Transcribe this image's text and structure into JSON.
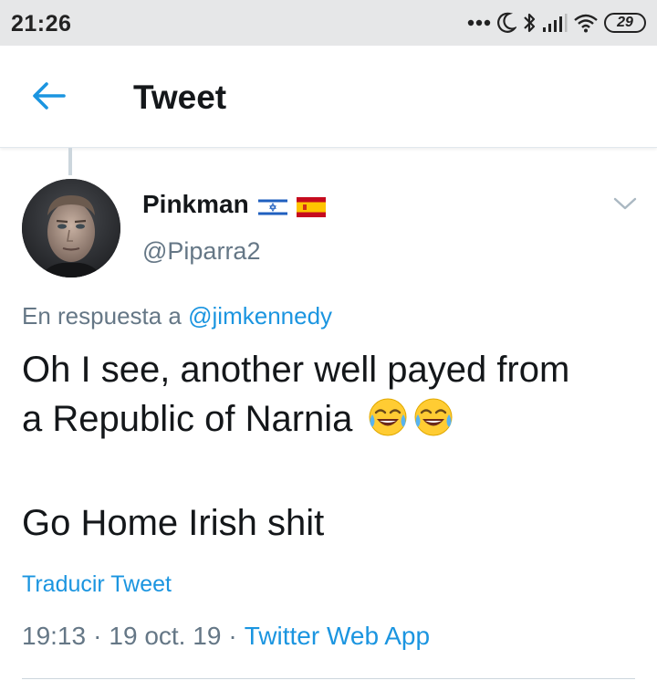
{
  "status_bar": {
    "time": "21:26",
    "battery": "29",
    "icons": [
      "more-dots-icon",
      "moon-icon",
      "bluetooth-icon",
      "signal-icon",
      "wifi-icon",
      "battery-icon"
    ]
  },
  "header": {
    "title": "Tweet",
    "back_icon": "arrow-left-icon",
    "accent_color": "#1b95e0"
  },
  "tweet": {
    "display_name": "Pinkman",
    "flags": [
      "israel-flag-icon",
      "spain-flag-icon"
    ],
    "username": "@Piparra2",
    "reply_prefix": "En respuesta a",
    "reply_to": "@jimkennedy",
    "text_line1": "Oh I see, another well payed from",
    "text_line2": "a Republic of Narnia",
    "text_emojis": [
      "face-with-tears-of-joy-emoji",
      "face-with-tears-of-joy-emoji"
    ],
    "text_line3": "Go Home Irish shit",
    "translate_label": "Traducir Tweet",
    "time": "19:13",
    "date": "19 oct. 19",
    "separator": "·",
    "source_app": "Twitter Web App"
  }
}
